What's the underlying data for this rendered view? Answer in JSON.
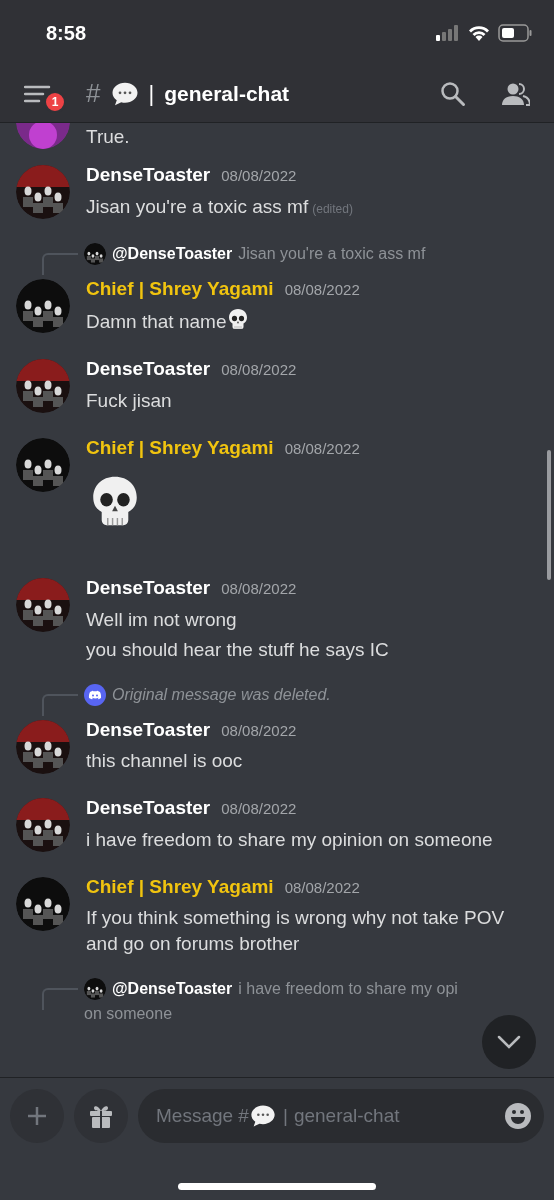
{
  "status_bar": {
    "time": "8:58"
  },
  "header": {
    "badge": "1",
    "hash": "#",
    "separator": "|",
    "channel": "general-chat"
  },
  "messages": [
    {
      "kind": "partial",
      "text": [
        "True."
      ]
    },
    {
      "kind": "message",
      "author": "DenseToaster",
      "color": "#ffffff",
      "timestamp": "08/08/2022",
      "text": [
        "Jisan you're a toxic ass mf"
      ],
      "edited": "(edited)"
    },
    {
      "kind": "message",
      "reply": {
        "kind": "quote",
        "author": "@DenseToaster",
        "text": "Jisan you're a toxic ass mf"
      },
      "author": "Chief | Shrey Yagami",
      "color": "#f1c40f",
      "timestamp": "08/08/2022",
      "text": [
        "Damn that name"
      ],
      "skull_emoji": true
    },
    {
      "kind": "message",
      "author": "DenseToaster",
      "color": "#ffffff",
      "timestamp": "08/08/2022",
      "text": [
        "Fuck jisan"
      ]
    },
    {
      "kind": "jumbo",
      "author": "Chief | Shrey Yagami",
      "color": "#f1c40f",
      "timestamp": "08/08/2022"
    },
    {
      "kind": "message",
      "author": "DenseToaster",
      "color": "#ffffff",
      "timestamp": "08/08/2022",
      "text": [
        "Well im not wrong",
        "you should hear the stuff he says IC"
      ]
    },
    {
      "kind": "message",
      "reply": {
        "kind": "deleted",
        "text": "Original message was deleted."
      },
      "author": "DenseToaster",
      "color": "#ffffff",
      "timestamp": "08/08/2022",
      "text": [
        "this channel is ooc"
      ]
    },
    {
      "kind": "message",
      "author": "DenseToaster",
      "color": "#ffffff",
      "timestamp": "08/08/2022",
      "text": [
        "i have freedom to share my opinion on someone"
      ]
    },
    {
      "kind": "message",
      "author": "Chief | Shrey Yagami",
      "color": "#f1c40f",
      "timestamp": "08/08/2022",
      "text": [
        "If you think something is wrong why not take POV and go on forums brother"
      ]
    },
    {
      "kind": "cut",
      "reply": {
        "kind": "quote",
        "author": "@DenseToaster",
        "text": "i have freedom to share my opi",
        "text_2": "on someone"
      }
    }
  ],
  "composer": {
    "placeholder_prefix": "Message #",
    "placeholder_sep": "|",
    "placeholder": "general-chat"
  }
}
